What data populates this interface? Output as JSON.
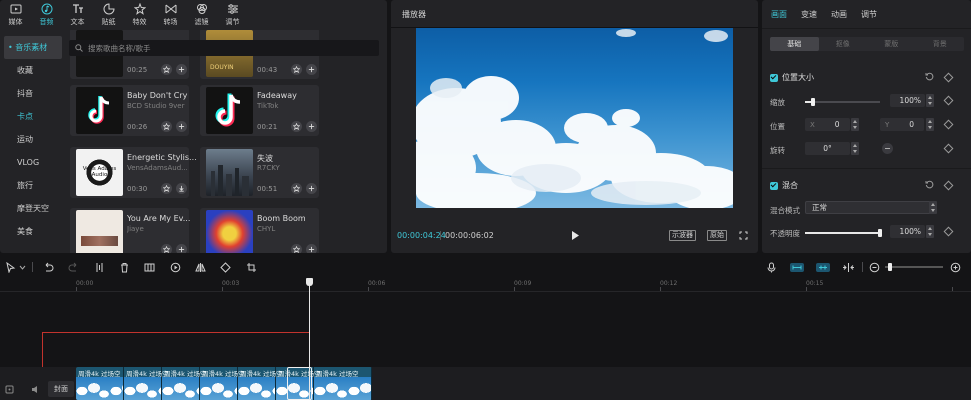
{
  "toolbar": {
    "items": [
      {
        "label": "媒体",
        "icon": "media-icon"
      },
      {
        "label": "音频",
        "icon": "audio-icon"
      },
      {
        "label": "文本",
        "icon": "text-icon"
      },
      {
        "label": "贴纸",
        "icon": "sticker-icon"
      },
      {
        "label": "特效",
        "icon": "effects-icon"
      },
      {
        "label": "转场",
        "icon": "transition-icon"
      },
      {
        "label": "滤镜",
        "icon": "filter-icon"
      },
      {
        "label": "调节",
        "icon": "adjust-icon"
      }
    ],
    "active_index": 1
  },
  "categories": {
    "items": [
      "• 音乐素材",
      "收藏",
      "抖音",
      "卡点",
      "运动",
      "VLOG",
      "旅行",
      "摩登天空",
      "美食"
    ],
    "active_index": 0,
    "highlight_index": 3
  },
  "search": {
    "placeholder": "搜索歌曲名称/歌手"
  },
  "music_cards": [
    {
      "title": "",
      "artist": "",
      "duration": "00:25"
    },
    {
      "title": "",
      "artist": "",
      "duration": "00:43"
    },
    {
      "title": "Baby Don't Cry",
      "artist": "BCD Studio 9ver",
      "duration": "00:26"
    },
    {
      "title": "Fadeaway",
      "artist": "TikTok",
      "duration": "00:21"
    },
    {
      "title": "Energetic Stylis...",
      "artist": "VensAdamsAud...",
      "duration": "00:30"
    },
    {
      "title": "失波",
      "artist": "R7CKY",
      "duration": "00:51"
    },
    {
      "title": "You Are My Ev...",
      "artist": "Jiaye",
      "duration": ""
    },
    {
      "title": "Boom Boom",
      "artist": "CHYL",
      "duration": ""
    }
  ],
  "thumb_text": {
    "vens": "Vens Adams\nAudio",
    "douyin": "DOUYIN"
  },
  "player": {
    "title": "播放器",
    "current_time": "00:00:04:24",
    "total_time": "00:00:06:02",
    "btn_oscilloscope": "示波器",
    "btn_original": "原始"
  },
  "inspector": {
    "tabs": [
      "画面",
      "变速",
      "动画",
      "调节"
    ],
    "active_tab": 0,
    "subtabs": [
      "基础",
      "抠像",
      "蒙版",
      "背景"
    ],
    "active_subtab": 0,
    "position_size": {
      "title": "位置大小",
      "scale_label": "缩放",
      "scale_value": "100%",
      "scale_fraction": 0.1,
      "position_label": "位置",
      "x_key": "X",
      "x_value": "0",
      "y_key": "Y",
      "y_value": "0",
      "rotate_label": "旋转",
      "rotate_value": "0°"
    },
    "blend": {
      "title": "混合",
      "mode_label": "混合模式",
      "mode_value": "正常",
      "opacity_label": "不透明度",
      "opacity_value": "100%",
      "opacity_fraction": 1.0
    }
  },
  "timeline": {
    "ruler_ticks": [
      "00:00",
      "00:03",
      "00:06",
      "00:09",
      "00:12",
      "00:15"
    ],
    "cover_label": "封面",
    "clip_label": "周滑4k 过场空",
    "zoom_fraction": 0.05
  },
  "colors": {
    "accent": "#3fc8d8",
    "selection": "#c2332d",
    "clip": "#1c5670"
  }
}
